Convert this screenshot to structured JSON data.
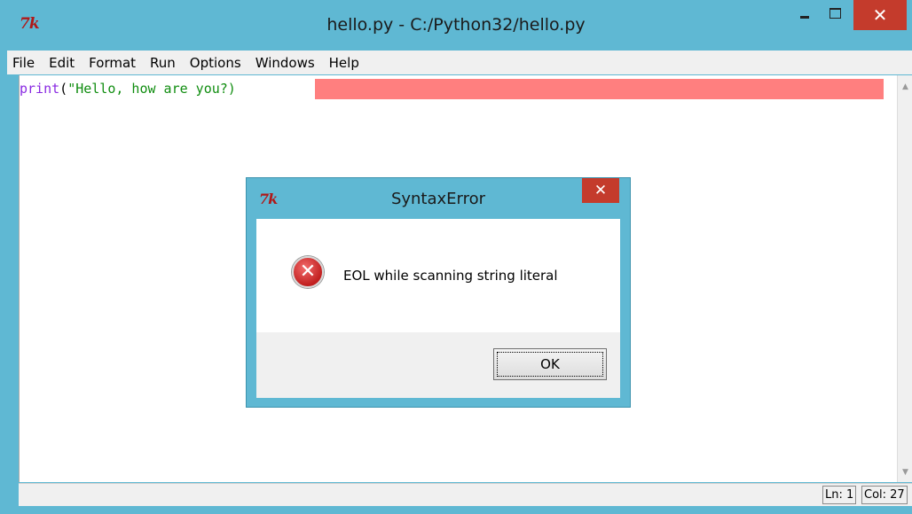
{
  "window": {
    "title": "hello.py - C:/Python32/hello.py",
    "logo": "7k",
    "close_glyph": "✕"
  },
  "menu": {
    "items": [
      "File",
      "Edit",
      "Format",
      "Run",
      "Options",
      "Windows",
      "Help"
    ]
  },
  "editor": {
    "code_func": "print",
    "code_paren": "(",
    "code_string": "\"Hello, how are you?)",
    "highlight_color": "#ff7f7f"
  },
  "status": {
    "ln": "Ln: 1",
    "col": "Col: 27"
  },
  "dialog": {
    "logo": "7k",
    "title": "SyntaxError",
    "close_glyph": "✕",
    "icon": "error-icon",
    "icon_glyph": "✕",
    "message": "EOL while scanning string literal",
    "ok_label": "OK"
  },
  "colors": {
    "window_frame": "#5fb8d3",
    "close_button": "#c43b2c"
  }
}
